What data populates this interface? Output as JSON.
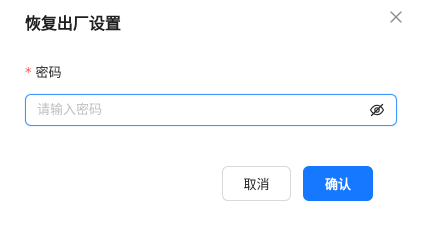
{
  "dialog": {
    "title": "恢复出厂设置",
    "close_icon": "close-icon"
  },
  "form": {
    "password": {
      "required_mark": "*",
      "label": "密码",
      "value": "",
      "placeholder": "请输入密码",
      "visibility_icon": "eye-slash-icon"
    }
  },
  "footer": {
    "cancel_label": "取消",
    "confirm_label": "确认"
  },
  "colors": {
    "primary": "#1677ff",
    "focus_border": "#4096ff",
    "required": "#ff4d4f",
    "placeholder": "#bfbfbf"
  }
}
